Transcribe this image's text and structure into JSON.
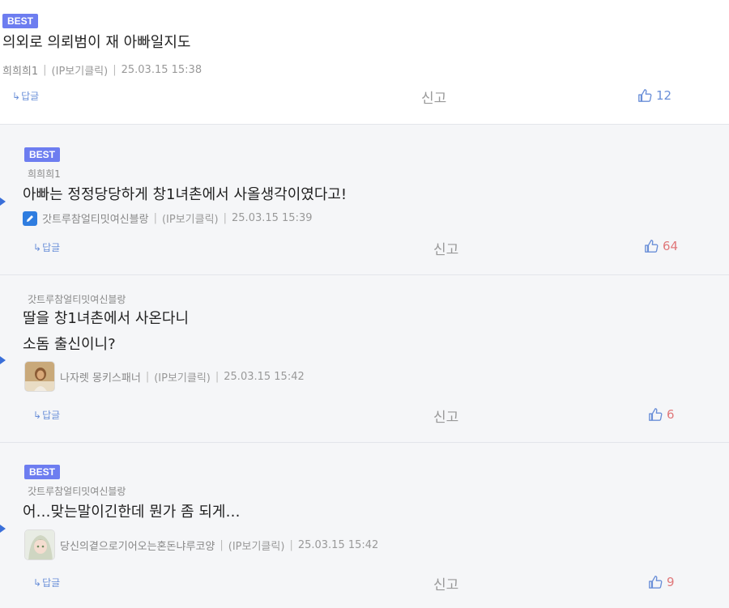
{
  "actions": {
    "reply_label": "답글",
    "reply_arrow": "↳",
    "report_label": "신고"
  },
  "comments": [
    {
      "badge": "BEST",
      "text_lines": [
        "의외로 의뢰범이 재 아빠일지도"
      ],
      "nickname": "희희희1",
      "ip_label": "(IP보기클릭)",
      "datetime": "25.03.15 15:38",
      "likes": "12"
    },
    {
      "badge": "BEST",
      "parent": "희희희1",
      "text_lines": [
        "아빠는 정정당당하게 창1녀촌에서 사올생각이였다고!"
      ],
      "nickname": "갓트루참얼티밋여신블랑",
      "ip_label": "(IP보기클릭)",
      "datetime": "25.03.15 15:39",
      "likes": "64",
      "icon": "pencil-icon"
    },
    {
      "parent": "갓트루참얼티밋여신블랑",
      "text_lines": [
        "딸을 창1녀촌에서 사온다니",
        "소돔 출신이니?"
      ],
      "nickname": "나자렛 몽키스패너",
      "ip_label": "(IP보기클릭)",
      "datetime": "25.03.15 15:42",
      "likes": "6",
      "icon": "avatar"
    },
    {
      "badge": "BEST",
      "parent": "갓트루참얼티밋여신블랑",
      "text_lines": [
        "어…맞는말이긴한데 뭔가 좀 되게…"
      ],
      "nickname": "당신의곁으로기어오는혼돈냐루코양",
      "ip_label": "(IP보기클릭)",
      "datetime": "25.03.15 15:42",
      "likes": "9",
      "icon": "avatar"
    }
  ],
  "colors": {
    "badge_bg": "#6d7df0",
    "reply_bg": "#f5f6f8",
    "link_blue": "#6a8fd8",
    "like_red": "#e0787a",
    "reply_marker": "#3a6fd9"
  }
}
